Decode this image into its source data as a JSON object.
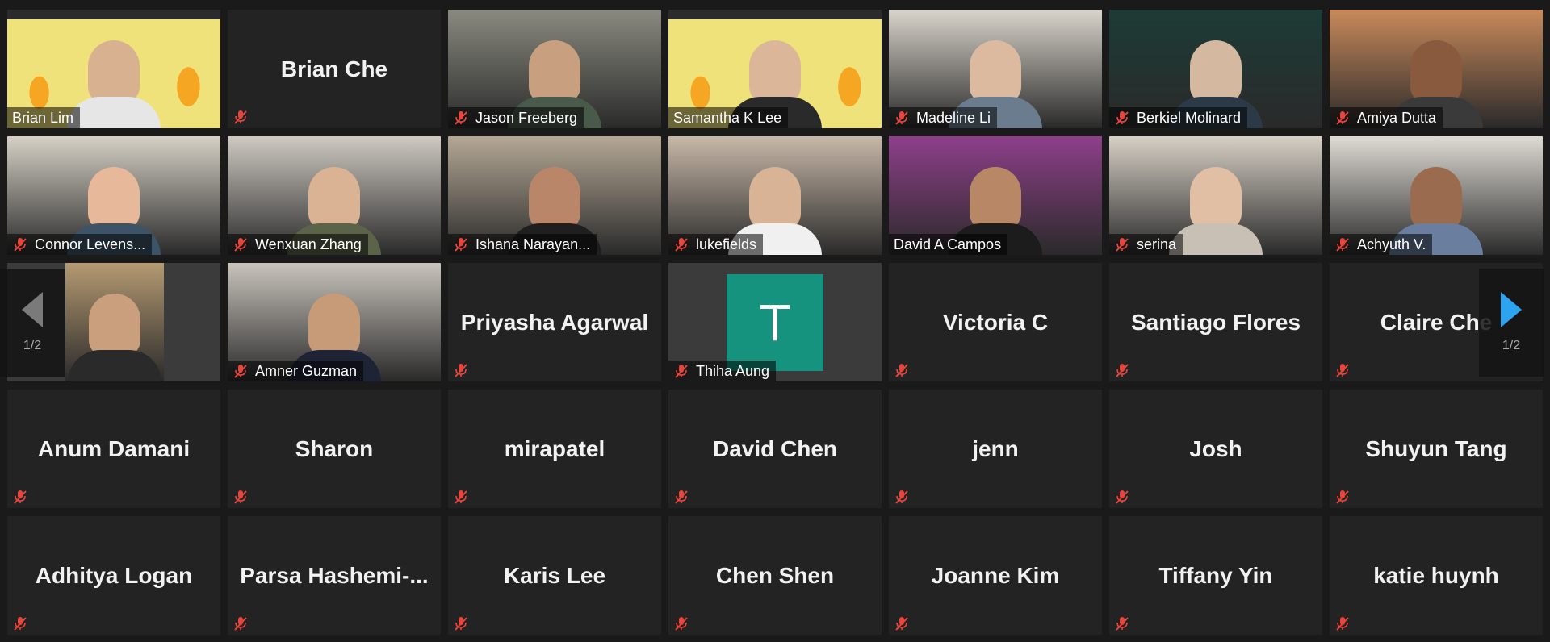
{
  "colors": {
    "accent_active": "#d4e157",
    "nav_arrow_active": "#2da4f0",
    "nav_arrow_inactive": "#7a7a7a",
    "avatar_bg": "#16937f",
    "mute_icon": "#e8453c"
  },
  "pagination": {
    "left": "1/2",
    "right": "1/2"
  },
  "tiles": [
    {
      "name": "Brian Lim",
      "type": "video",
      "muted": false,
      "scene": "flame",
      "skin": "#d8b191",
      "shirt": "#e6e6e6"
    },
    {
      "name": "Brian Che",
      "type": "name",
      "muted": true
    },
    {
      "name": "Jason Freeberg",
      "type": "video",
      "muted": true,
      "bg": "#8a8a80",
      "skin": "#c9a07f",
      "shirt": "#4a5a4a"
    },
    {
      "name": "Samantha K Lee",
      "type": "video",
      "muted": false,
      "scene": "flame",
      "skin": "#dbb699",
      "shirt": "#2a2a2a"
    },
    {
      "name": "Madeline Li",
      "type": "video",
      "muted": true,
      "bg": "#d9d4cb",
      "skin": "#dcbaa0",
      "shirt": "#6b7c8e"
    },
    {
      "name": "Berkiel Molinard",
      "type": "video",
      "muted": true,
      "bg": "#1d3b36",
      "skin": "#d4b8a0",
      "shirt": "#2c3a48"
    },
    {
      "name": "Amiya Dutta",
      "type": "video",
      "muted": true,
      "bg": "#c98a5a",
      "skin": "#8a5a3e",
      "shirt": "#3a3a3a"
    },
    {
      "name": "Connor Levens...",
      "type": "video",
      "muted": true,
      "bg": "#d6d1c6",
      "skin": "#e8b89a",
      "shirt": "#3d5468"
    },
    {
      "name": "Wenxuan Zhang",
      "type": "video",
      "muted": true,
      "bg": "#cfcac2",
      "skin": "#d9b394",
      "shirt": "#5b6348"
    },
    {
      "name": "Ishana Narayan...",
      "type": "video",
      "muted": true,
      "bg": "#b4a895",
      "skin": "#b9866a",
      "shirt": "#1f1f1f"
    },
    {
      "name": "lukefields",
      "type": "video",
      "muted": true,
      "bg": "#c8b8a8",
      "skin": "#d8b396",
      "shirt": "#f0f0f0"
    },
    {
      "name": "David A Campos",
      "type": "video",
      "muted": false,
      "active": true,
      "bg": "#8e3f8a",
      "skin": "#b88866",
      "shirt": "#1c1c1c"
    },
    {
      "name": "serina",
      "type": "video",
      "muted": true,
      "bg": "#d7d0c5",
      "skin": "#e1bfa5",
      "shirt": "#c9c0b5"
    },
    {
      "name": "Achyuth V.",
      "type": "video",
      "muted": true,
      "bg": "#dedbd4",
      "skin": "#9a6b4e",
      "shirt": "#6a7fa0"
    },
    {
      "name": "",
      "type": "video",
      "muted": false,
      "partial": true,
      "bg": "#b59a72",
      "skin": "#c99f7e",
      "shirt": "#2a2a2a"
    },
    {
      "name": "Amner Guzman",
      "type": "video",
      "muted": true,
      "bg": "#c9c4bc",
      "skin": "#c79a78",
      "shirt": "#1e2436"
    },
    {
      "name": "Priyasha Agarwal",
      "type": "name",
      "muted": true
    },
    {
      "name": "Thiha Aung",
      "type": "avatar",
      "muted": true,
      "letter": "T"
    },
    {
      "name": "Victoria C",
      "type": "name",
      "muted": true
    },
    {
      "name": "Santiago Flores",
      "type": "name",
      "muted": true
    },
    {
      "name": "Claire Che",
      "type": "name",
      "muted": true
    },
    {
      "name": "Anum Damani",
      "type": "name",
      "muted": true
    },
    {
      "name": "Sharon",
      "type": "name",
      "muted": true
    },
    {
      "name": "mirapatel",
      "type": "name",
      "muted": true
    },
    {
      "name": "David Chen",
      "type": "name",
      "muted": true
    },
    {
      "name": "jenn",
      "type": "name",
      "muted": true
    },
    {
      "name": "Josh",
      "type": "name",
      "muted": true
    },
    {
      "name": "Shuyun Tang",
      "type": "name",
      "muted": true
    },
    {
      "name": "Adhitya Logan",
      "type": "name",
      "muted": true
    },
    {
      "name": "Parsa  Hashemi-...",
      "type": "name",
      "muted": true
    },
    {
      "name": "Karis Lee",
      "type": "name",
      "muted": true
    },
    {
      "name": "Chen Shen",
      "type": "name",
      "muted": true
    },
    {
      "name": "Joanne Kim",
      "type": "name",
      "muted": true
    },
    {
      "name": "Tiffany Yin",
      "type": "name",
      "muted": true
    },
    {
      "name": "katie huynh",
      "type": "name",
      "muted": true
    }
  ]
}
